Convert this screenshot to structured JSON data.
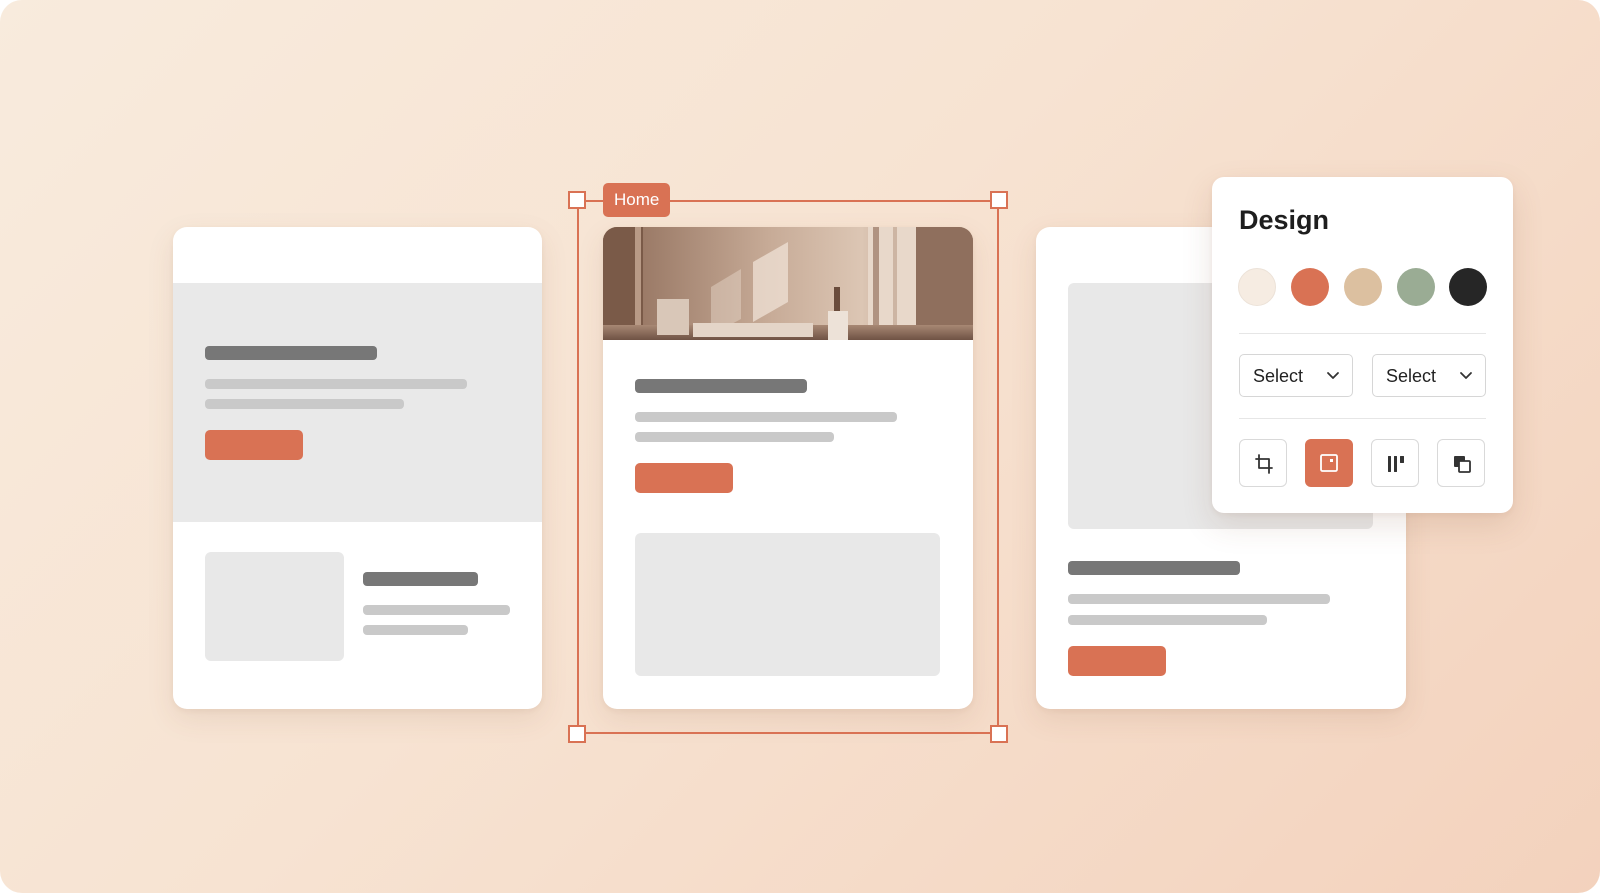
{
  "colors": {
    "accent": "#d97254",
    "skeleton_dark": "#777777",
    "skeleton_light": "#c9c9c9",
    "placeholder": "#e8e8e8"
  },
  "canvas": {
    "selected_frame": {
      "tag_label": "Home"
    },
    "cards": [
      {
        "name": "card-left",
        "contains_image": false
      },
      {
        "name": "card-home",
        "contains_image": true,
        "image_description": "sunlit interior room"
      },
      {
        "name": "card-right",
        "contains_image": false
      }
    ]
  },
  "design_panel": {
    "title": "Design",
    "swatches": [
      {
        "name": "cream",
        "color": "#f6ece2"
      },
      {
        "name": "terracotta",
        "color": "#d97254"
      },
      {
        "name": "sand",
        "color": "#dcc0a0"
      },
      {
        "name": "sage",
        "color": "#9aac94"
      },
      {
        "name": "charcoal",
        "color": "#262626"
      }
    ],
    "selects": [
      {
        "label": "Select"
      },
      {
        "label": "Select"
      }
    ],
    "tools": [
      {
        "icon": "crop-icon",
        "active": false
      },
      {
        "icon": "frame-icon",
        "active": true
      },
      {
        "icon": "columns-icon",
        "active": false
      },
      {
        "icon": "layers-icon",
        "active": false
      }
    ]
  }
}
